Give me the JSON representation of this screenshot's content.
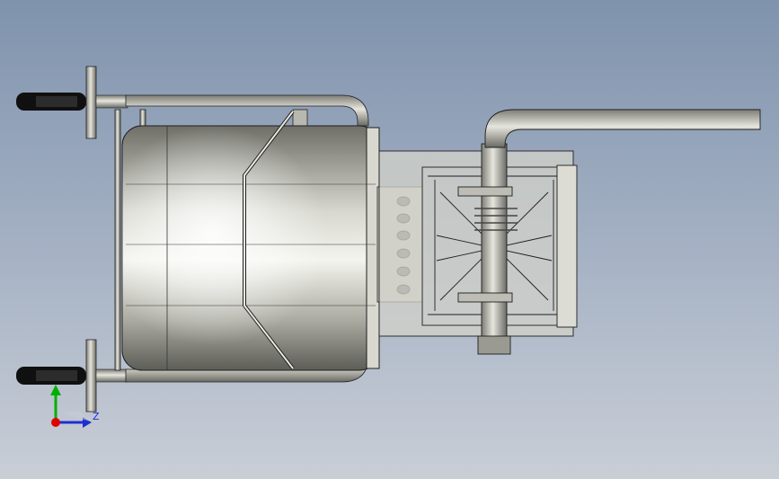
{
  "viewport": {
    "view": "top-view",
    "background_top": "#7f93ad",
    "background_bottom": "#c9ced6"
  },
  "model": {
    "body_color": "#c8c8be",
    "edge_color": "#1e1e1e",
    "wheel_color": "#101010"
  },
  "triad": {
    "z_label": "Z",
    "x_color": "#e00000",
    "y_color": "#00b000",
    "z_color": "#1e2fd0"
  }
}
